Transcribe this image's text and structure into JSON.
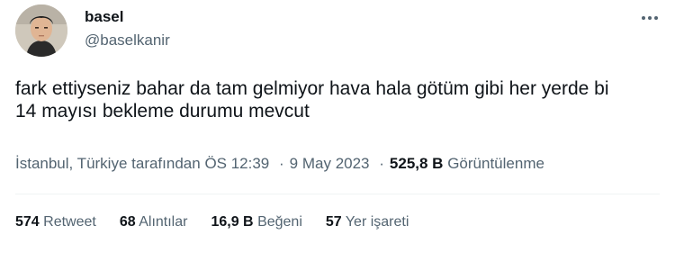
{
  "user": {
    "display_name": "basel",
    "handle": "@baselkanir",
    "avatar_icon": "avatar-photo"
  },
  "tweet": {
    "line1": "fark ettiyseniz bahar da tam gelmiyor hava hala götüm gibi her yerde bi",
    "line2": "14 mayısı bekleme durumu mevcut"
  },
  "meta": {
    "location": "İstanbul, Türkiye tarafından",
    "time": "ÖS 12:39",
    "date": "9 May 2023",
    "views_count": "525,8 B",
    "views_label": "Görüntülenme",
    "separator": "·"
  },
  "stats": {
    "retweets_count": "574",
    "retweets_label": "Retweet",
    "quotes_count": "68",
    "quotes_label": "Alıntılar",
    "likes_count": "16,9 B",
    "likes_label": "Beğeni",
    "bookmarks_count": "57",
    "bookmarks_label": "Yer işareti"
  },
  "colors": {
    "text": "#0f1419",
    "secondary": "#536471",
    "divider": "#eff3f4"
  },
  "icons": {
    "more": "more-dots-icon"
  }
}
